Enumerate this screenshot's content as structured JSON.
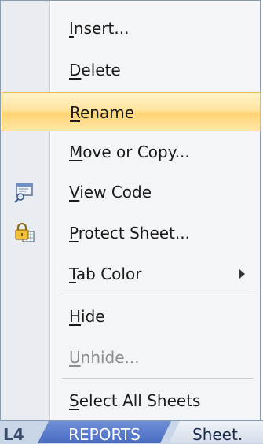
{
  "context_menu": {
    "items": [
      {
        "label_u": "I",
        "label_rest": "nsert..."
      },
      {
        "label_u": "D",
        "label_rest": "elete"
      },
      {
        "label_u": "R",
        "label_rest": "ename"
      },
      {
        "label_pre": "",
        "label_u": "M",
        "label_rest": "ove or Copy..."
      },
      {
        "label_u": "V",
        "label_rest": "iew Code",
        "icon": "view-code-icon"
      },
      {
        "label_u": "P",
        "label_rest": "rotect Sheet...",
        "icon": "protect-sheet-lock-icon"
      },
      {
        "label_u": "T",
        "label_rest": "ab Color",
        "submenu": true
      },
      {
        "label_u": "H",
        "label_rest": "ide"
      },
      {
        "label_u": "U",
        "label_rest": "nhide...",
        "disabled": true
      },
      {
        "label_u": "S",
        "label_rest": "elect All Sheets"
      }
    ],
    "highlighted_item": "Rename"
  },
  "sheet_tabs": {
    "left_fragment": "L4",
    "active_tab": "REPORTS",
    "next_tab": "Sheet."
  },
  "colors": {
    "highlight_top": "#fff4cb",
    "highlight_bottom": "#ffd575",
    "active_tab": "#4a6cc2"
  }
}
